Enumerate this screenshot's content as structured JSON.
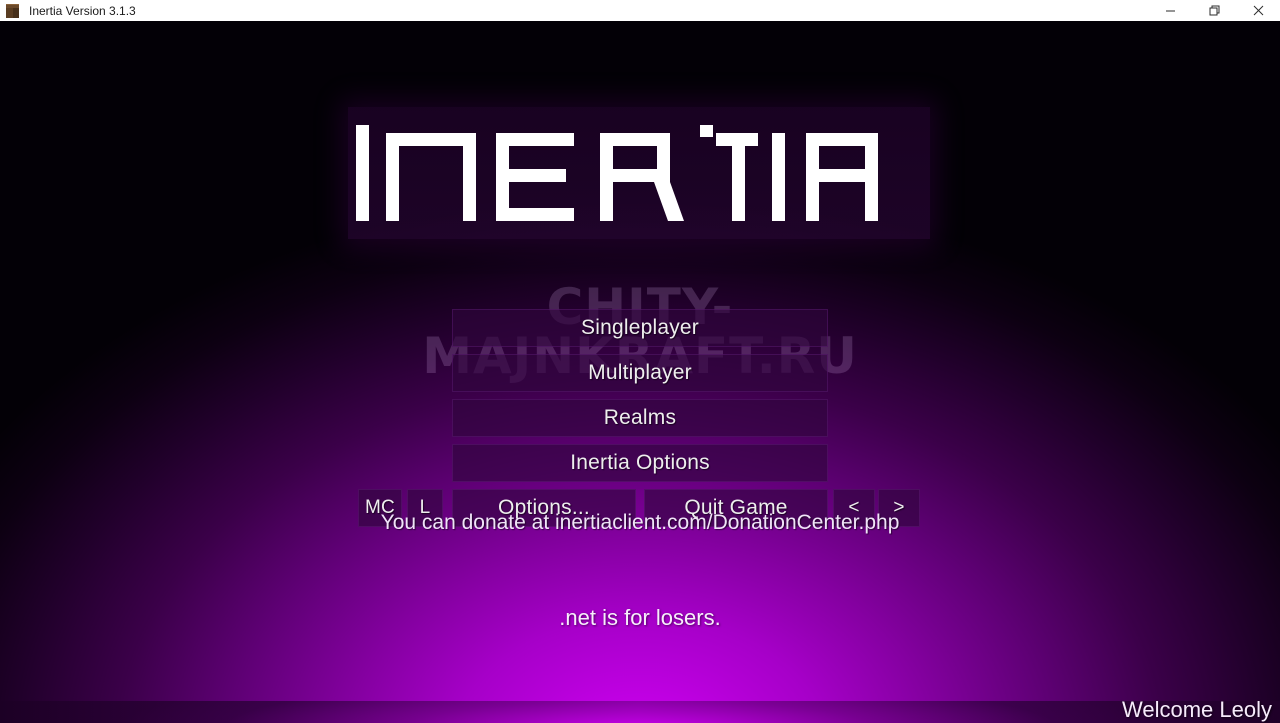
{
  "window": {
    "title": "Inertia Version 3.1.3",
    "icon": "minecraft-block-icon",
    "controls": {
      "minimize": "minimize-icon",
      "restore": "restore-icon",
      "close": "close-icon"
    }
  },
  "logo": {
    "text": "INERTIA",
    "style": "geometric-wordmark",
    "color": "#ffffff",
    "banner_color": "#24042f"
  },
  "watermark": {
    "line1": "CHITY-",
    "line2": "MAJNKRAFT.RU"
  },
  "menu": {
    "singleplayer": "Singleplayer",
    "multiplayer": "Multiplayer",
    "realms": "Realms",
    "inertia_options": "Inertia Options",
    "mc": "MC",
    "l": "L",
    "options": "Options...",
    "quit": "Quit Game",
    "prev": "<",
    "next": ">"
  },
  "footer": {
    "donate": "You can donate at inertiaclient.com/DonationCenter.php",
    "splash": ".net is for losers.",
    "welcome": "Welcome Leoly"
  },
  "theme": {
    "accent": "#bf00e0",
    "background_dark": "#030005",
    "button_fill": "#2e053c",
    "text": "#eeeeee"
  }
}
